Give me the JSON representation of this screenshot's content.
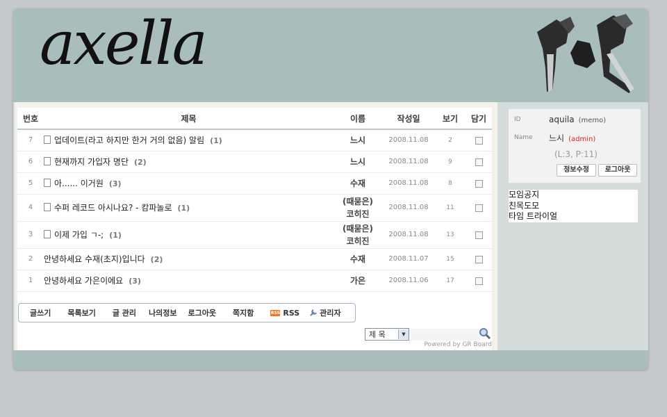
{
  "header": {
    "logo_text": "axella"
  },
  "board": {
    "columns": {
      "no": "번호",
      "title": "제목",
      "name": "이름",
      "date": "작성일",
      "views": "보기",
      "pick": "담기"
    },
    "rows": [
      {
        "no": "7",
        "title": "업데이트(라고 하지만 한거 거의 없음) 알림",
        "comments": "(1)",
        "name1": "느시",
        "name2": "",
        "date": "2008.11.08",
        "views": "2",
        "has_icon": true
      },
      {
        "no": "6",
        "title": "현재까지 가입자 명단",
        "comments": "(2)",
        "name1": "느시",
        "name2": "",
        "date": "2008.11.08",
        "views": "9",
        "has_icon": true
      },
      {
        "no": "5",
        "title": "아...... 이거원",
        "comments": "(3)",
        "name1": "수재",
        "name2": "",
        "date": "2008.11.08",
        "views": "8",
        "has_icon": true
      },
      {
        "no": "4",
        "title": "수퍼 레코드 아시나요? - 캄파놀로",
        "comments": "(1)",
        "name1": "(때묻은)",
        "name2": "코히진",
        "date": "2008.11.08",
        "views": "11",
        "has_icon": true
      },
      {
        "no": "3",
        "title": "이제 가입 ㄱ-;",
        "comments": "(1)",
        "name1": "(때묻은)",
        "name2": "코히진",
        "date": "2008.11.08",
        "views": "13",
        "has_icon": true
      },
      {
        "no": "2",
        "title": "안녕하세요 수재(초지)입니다",
        "comments": "(2)",
        "name1": "수재",
        "name2": "",
        "date": "2008.11.07",
        "views": "15",
        "has_icon": false
      },
      {
        "no": "1",
        "title": "안녕하세요 가은이에요",
        "comments": "(3)",
        "name1": "가은",
        "name2": "",
        "date": "2008.11.06",
        "views": "17",
        "has_icon": false
      }
    ]
  },
  "toolbar": {
    "write": "글쓰기",
    "list": "목록보기",
    "manage": "글 관리",
    "myinfo": "나의정보",
    "logout": "로그아웃",
    "memo": "쪽지함",
    "rss": "RSS",
    "rss_badge": "RSS",
    "admin": "관리자"
  },
  "search": {
    "select_value": "제 목"
  },
  "powered": "Powered by GR Board",
  "login": {
    "id_label": "ID",
    "id_value": "aquila",
    "memo_link": "(memo)",
    "name_label": "Name",
    "name_value": "느시",
    "admin_link": "(admin)",
    "stats": "(L:3, P:11)",
    "edit_button": "정보수정",
    "logout_button": "로그아웃"
  },
  "links": [
    "모임공지",
    "친목도모",
    "타임 트라이얼"
  ],
  "colors": {
    "header_bg": "#a9bdbc",
    "frame_bg": "#d5dcdc",
    "admin_red": "#e02020"
  }
}
